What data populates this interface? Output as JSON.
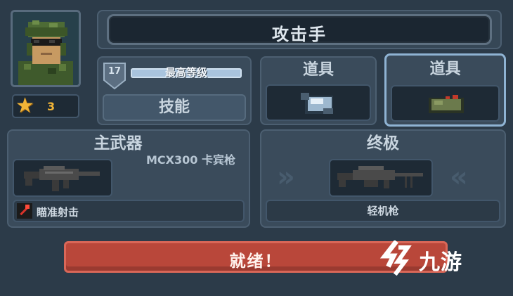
{
  "header": {
    "title": "攻击手"
  },
  "player": {
    "stars": "3",
    "level": "17",
    "level_label": "最高等级",
    "level_progress": 1.0
  },
  "skills": {
    "label": "技能"
  },
  "items": [
    {
      "label": "道具",
      "icon": "grenade-icon"
    },
    {
      "label": "道具",
      "icon": "mine-icon"
    }
  ],
  "primary": {
    "label": "主武器",
    "weapon_name": "MCX300 卡宾枪",
    "ability": "瞄准射击",
    "icon": "rifle-icon"
  },
  "ultimate": {
    "label": "终极",
    "weapon_name": "轻机枪",
    "icon": "machine-gun-icon"
  },
  "ready": {
    "label": "就绪！"
  },
  "watermark": {
    "text": "九游"
  },
  "colors": {
    "background": "#2c3b49",
    "ready": "#b9473a",
    "selected_border": "#8fb3d3",
    "title_text": "#dfe7ee"
  }
}
